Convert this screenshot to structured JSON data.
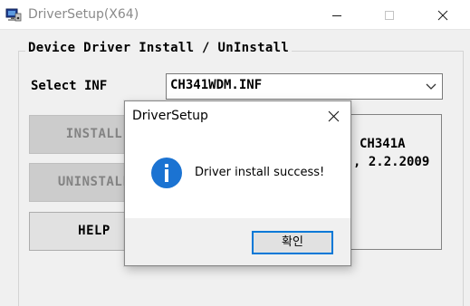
{
  "window": {
    "title": "DriverSetup(X64)",
    "controls": [
      "minimize-icon",
      "maximize-icon",
      "close-icon"
    ]
  },
  "group": {
    "title": "Device Driver Install / UnInstall"
  },
  "select": {
    "label": "Select INF",
    "value": "CH341WDM.INF"
  },
  "buttons": {
    "install": "INSTALL",
    "uninstall": "UNINSTALL",
    "help": "HELP"
  },
  "info_panel": {
    "line1": "CH341A",
    "line2": ", 2.2.2009"
  },
  "dialog": {
    "title": "DriverSetup",
    "message": "Driver install success!",
    "ok_label": "확인",
    "icon": "info-icon",
    "accent": "#0078d7"
  },
  "colors": {
    "background": "#f0f0f0",
    "info_icon": "#1b73d2",
    "disabled_text": "#838383"
  }
}
